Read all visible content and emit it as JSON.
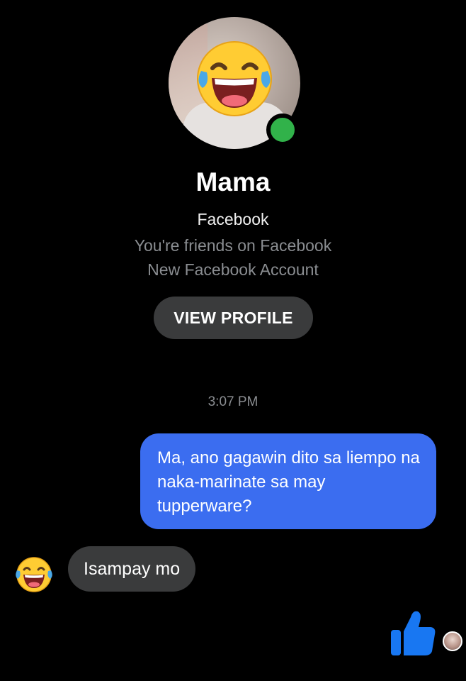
{
  "contact": {
    "name": "Mama",
    "source": "Facebook",
    "friend_status": "You're friends on Facebook",
    "account_note": "New Facebook Account",
    "view_profile_label": "VIEW PROFILE",
    "avatar_icon": "face-with-tears-of-joy-emoji",
    "online": true
  },
  "conversation": {
    "timestamp": "3:07 PM",
    "messages": [
      {
        "direction": "outgoing",
        "text": "Ma, ano gagawin dito sa liempo na naka-marinate sa may tupperware?"
      },
      {
        "direction": "incoming",
        "text": "Isampay mo",
        "sender_avatar_icon": "face-with-tears-of-joy-emoji"
      }
    ],
    "reaction_icon": "thumbs-up-icon",
    "seen_indicator": "seen-avatar"
  },
  "colors": {
    "background": "#000000",
    "outgoing_bubble": "#3b6df0",
    "incoming_bubble": "#3a3b3c",
    "online_dot": "#31b24a",
    "like_blue": "#1877f2"
  }
}
